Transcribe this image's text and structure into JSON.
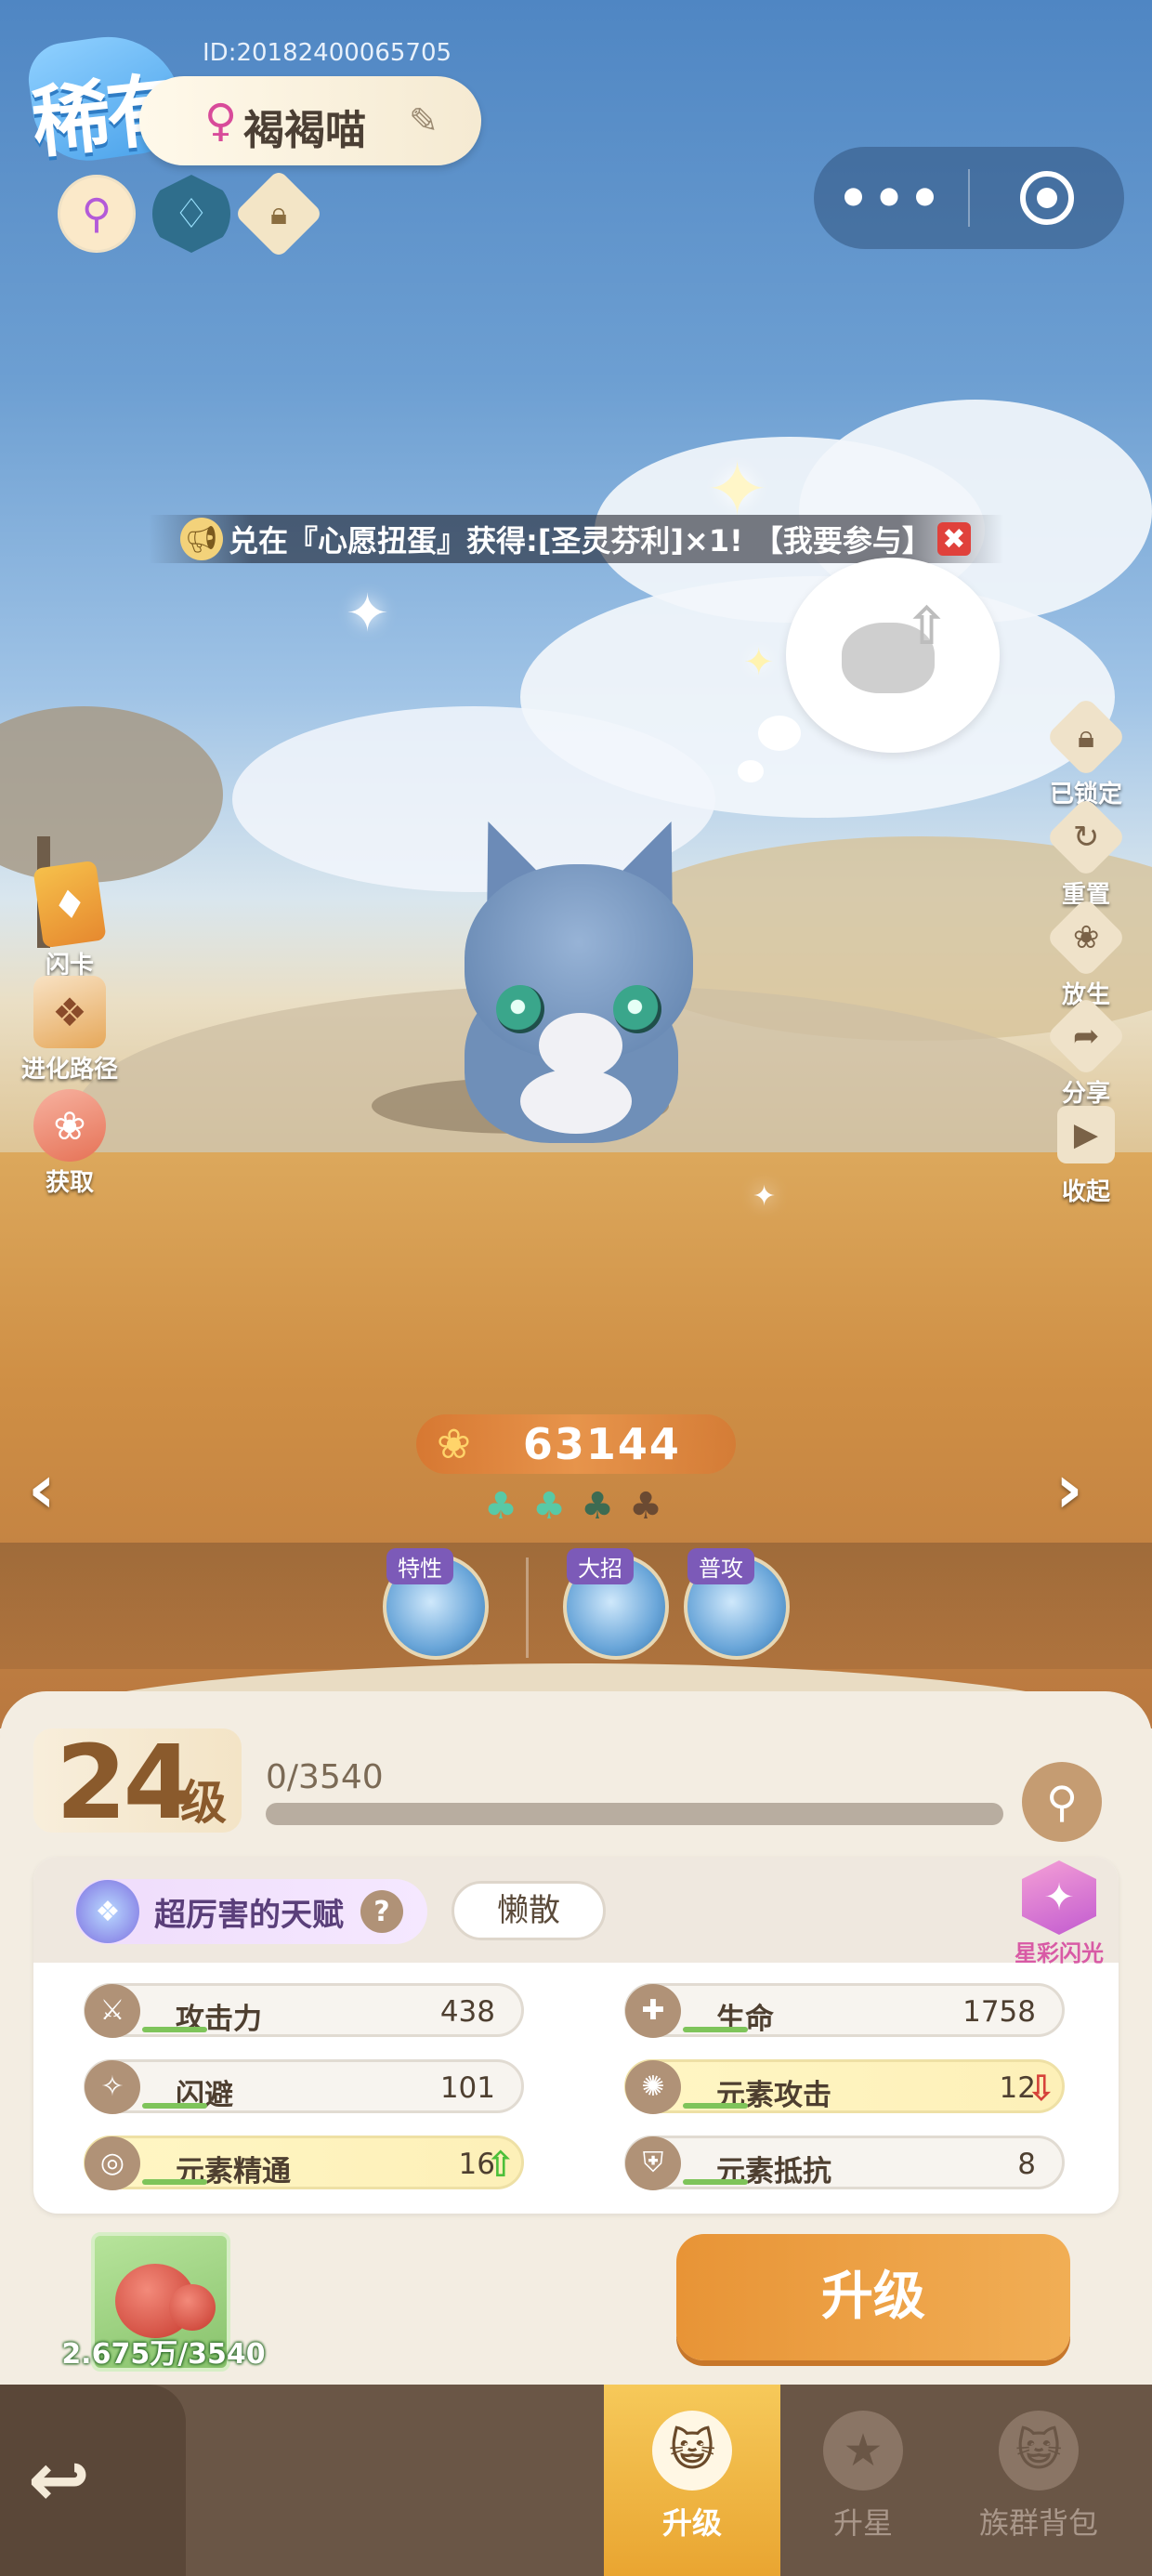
{
  "header": {
    "rarity": "稀有",
    "id_text": "ID:20182400065705",
    "gender_symbol": "♀",
    "pet_name": "褐褐喵",
    "edit_icon": "pencil-icon",
    "tags": [
      "key-icon",
      "water-element-icon",
      "lock-icon"
    ]
  },
  "capsule": {
    "more": "•••",
    "close_icon": "target-icon"
  },
  "marquee": {
    "message": "兑在『心愿扭蛋』获得:[圣灵芬利]×1! 【我要参与】",
    "close": "✖"
  },
  "left_menu": [
    {
      "label": "闪卡",
      "icon": "flash-card-icon"
    },
    {
      "label": "进化路径",
      "icon": "evolution-book-icon"
    },
    {
      "label": "获取",
      "icon": "paw-icon"
    }
  ],
  "right_menu": [
    {
      "label": "已锁定",
      "icon": "lock-icon"
    },
    {
      "label": "重置",
      "icon": "reset-icon"
    },
    {
      "label": "放生",
      "icon": "release-paw-icon"
    },
    {
      "label": "分享",
      "icon": "share-icon"
    },
    {
      "label": "收起",
      "icon": "collapse-icon"
    }
  ],
  "power": {
    "value": "63144",
    "icon": "paw-icon"
  },
  "clovers": {
    "filled": 2,
    "total": 4
  },
  "skills": [
    {
      "label": "特性"
    },
    {
      "label": "大招"
    },
    {
      "label": "普攻"
    }
  ],
  "level": {
    "number": "24",
    "unit": "级",
    "exp_text": "0/3540",
    "exp_fraction": 0.0
  },
  "talent": {
    "label": "超厉害的天赋",
    "help": "?",
    "trait": "懒散",
    "shine_label": "星彩闪光"
  },
  "stats": [
    {
      "name": "攻击力",
      "value": "438",
      "highlight": false,
      "arrow": "",
      "icon": "sword-icon"
    },
    {
      "name": "生命",
      "value": "1758",
      "highlight": false,
      "arrow": "",
      "icon": "heart-plus-icon"
    },
    {
      "name": "闪避",
      "value": "101",
      "highlight": false,
      "arrow": "",
      "icon": "dodge-icon"
    },
    {
      "name": "元素攻击",
      "value": "12",
      "highlight": true,
      "arrow": "down",
      "icon": "element-attack-icon"
    },
    {
      "name": "元素精通",
      "value": "16",
      "highlight": true,
      "arrow": "up",
      "icon": "element-mastery-icon"
    },
    {
      "name": "元素抵抗",
      "value": "8",
      "highlight": false,
      "arrow": "",
      "icon": "shield-icon"
    }
  ],
  "material": {
    "count": "2.675万/3540",
    "icon": "meat-icon"
  },
  "upgrade_button": "升级",
  "tabbar": {
    "back_icon": "back-arrow-icon",
    "tabs": [
      {
        "label": "升级",
        "active": true,
        "icon": "cat-face-icon"
      },
      {
        "label": "升星",
        "active": false,
        "icon": "star-icon"
      },
      {
        "label": "族群背包",
        "active": false,
        "icon": "cat-bag-icon"
      }
    ]
  }
}
